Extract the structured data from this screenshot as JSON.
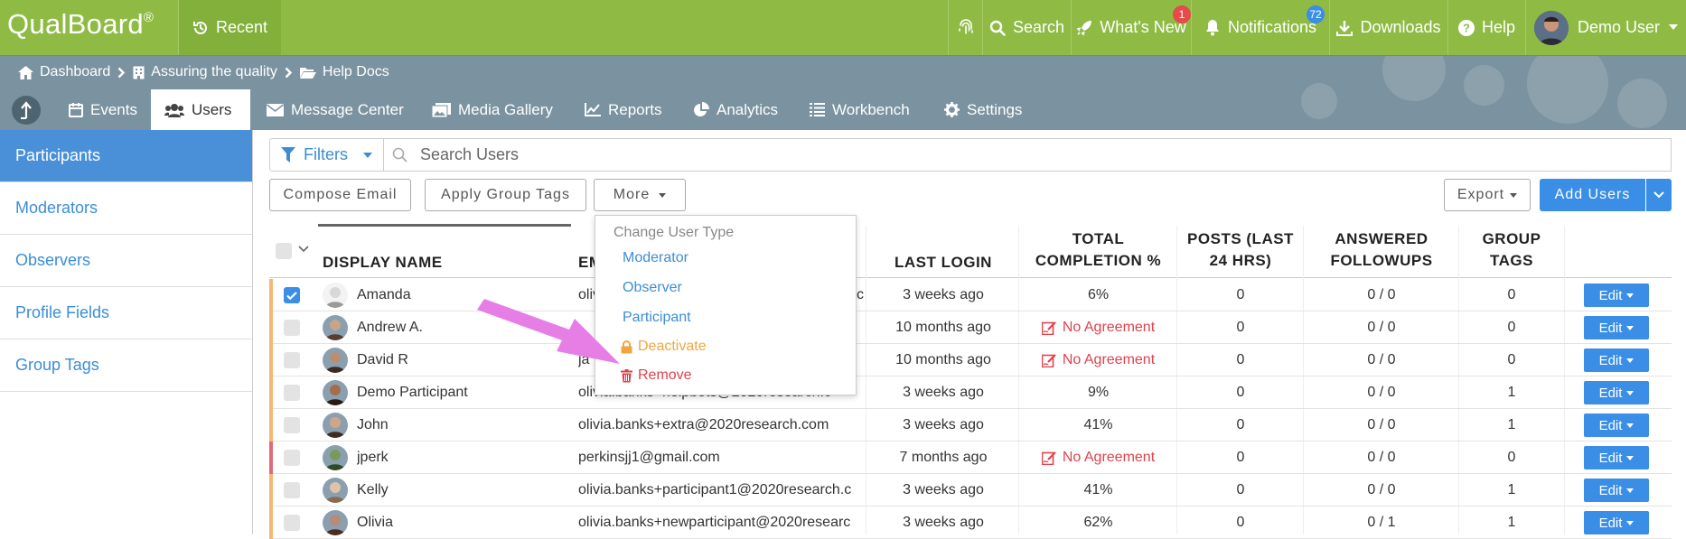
{
  "app": {
    "logo": "QualBoard",
    "logo_mark": "®"
  },
  "topbar": {
    "recent": "Recent",
    "search": "Search",
    "whats_new": "What's New",
    "whats_new_badge": "1",
    "notifications": "Notifications",
    "notifications_badge": "72",
    "downloads": "Downloads",
    "help": "Help",
    "user": "Demo User"
  },
  "breadcrumb": [
    "Dashboard",
    "Assuring the quality",
    "Help Docs"
  ],
  "tabs": [
    "Events",
    "Users",
    "Message Center",
    "Media Gallery",
    "Reports",
    "Analytics",
    "Workbench",
    "Settings"
  ],
  "sidebar": [
    "Participants",
    "Moderators",
    "Observers",
    "Profile Fields",
    "Group Tags"
  ],
  "toolbar": {
    "filters": "Filters",
    "search_placeholder": "Search Users",
    "compose": "Compose Email",
    "apply_tags": "Apply Group Tags",
    "more": "More",
    "export": "Export",
    "add_users": "Add Users"
  },
  "menu": {
    "header": "Change User Type",
    "moderator": "Moderator",
    "observer": "Observer",
    "participant": "Participant",
    "deactivate": "Deactivate",
    "remove": "Remove"
  },
  "columns": {
    "display_name": "DISPLAY NAME",
    "email_partial": "EM",
    "last_login": "LAST LOGIN",
    "completion_1": "TOTAL",
    "completion_2": "COMPLETION %",
    "posts_1": "POSTS (LAST",
    "posts_2": "24 HRS)",
    "answered_1": "ANSWERED",
    "answered_2": "FOLLOWUPS",
    "tags_1": "GROUP",
    "tags_2": "TAGS"
  },
  "edit_label": "Edit",
  "rows": [
    {
      "name": "Amanda",
      "email": "olivi",
      "email_tail": "c",
      "login": "3 weeks ago",
      "completion": "6%",
      "posts": "0",
      "answered": "0 / 0",
      "tags": "0",
      "checked": true
    },
    {
      "name": "Andrew A.",
      "email": "",
      "email_tail": "",
      "login": "10 months ago",
      "completion": "No Agreement",
      "posts": "0",
      "answered": "0 / 0",
      "tags": "0",
      "checked": false
    },
    {
      "name": "David R",
      "email": "ja",
      "email_tail": "",
      "login": "10 months ago",
      "completion": "No Agreement",
      "posts": "0",
      "answered": "0 / 0",
      "tags": "0",
      "checked": false
    },
    {
      "name": "Demo Participant",
      "email": "olivia.banks+helpbots@2020research.c",
      "email_tail": "",
      "login": "3 weeks ago",
      "completion": "9%",
      "posts": "0",
      "answered": "0 / 0",
      "tags": "1",
      "checked": false
    },
    {
      "name": "John",
      "email": "olivia.banks+extra@2020research.com",
      "email_tail": "",
      "login": "3 weeks ago",
      "completion": "41%",
      "posts": "0",
      "answered": "0 / 0",
      "tags": "1",
      "checked": false
    },
    {
      "name": "jperk",
      "email": "perkinsjj1@gmail.com",
      "email_tail": "",
      "login": "7 months ago",
      "completion": "No Agreement",
      "posts": "0",
      "answered": "0 / 0",
      "tags": "0",
      "checked": false
    },
    {
      "name": "Kelly",
      "email": "olivia.banks+participant1@2020research.c",
      "email_tail": "",
      "login": "3 weeks ago",
      "completion": "41%",
      "posts": "0",
      "answered": "0 / 0",
      "tags": "1",
      "checked": false
    },
    {
      "name": "Olivia",
      "email": "olivia.banks+newparticipant@2020researc",
      "email_tail": "",
      "login": "3 weeks ago",
      "completion": "62%",
      "posts": "0",
      "answered": "0 / 1",
      "tags": "1",
      "checked": false
    }
  ],
  "colors": {
    "topbar": "#8fbb45",
    "header": "#7b93a0",
    "accent": "#3a8ee6",
    "danger": "#e0424c",
    "warning": "#f0a640",
    "arrow": "#e77ee6"
  }
}
